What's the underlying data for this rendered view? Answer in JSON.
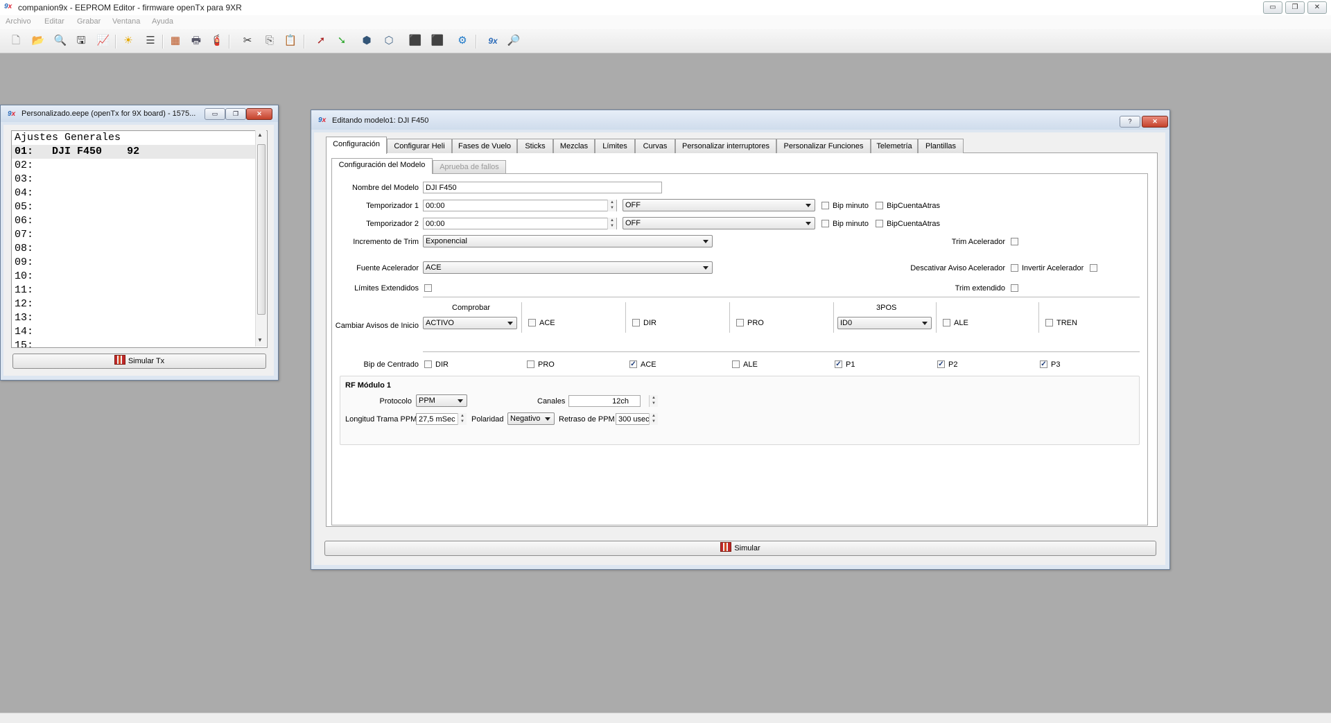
{
  "app": {
    "title": "companion9x - EEPROM Editor - firmware openTx para 9XR",
    "menu": [
      "Archivo",
      "Editar",
      "Grabar",
      "Ventana",
      "Ayuda"
    ],
    "window_controls": [
      "▭",
      "❐",
      "✕"
    ]
  },
  "eepe_window": {
    "title": "Personalizado.eepe (openTx for 9X board) - 1575...",
    "header": "Ajustes Generales",
    "models": [
      {
        "num": "01:",
        "name": "DJI F450",
        "size": "92"
      },
      {
        "num": "02:",
        "name": "",
        "size": ""
      },
      {
        "num": "03:",
        "name": "",
        "size": ""
      },
      {
        "num": "04:",
        "name": "",
        "size": ""
      },
      {
        "num": "05:",
        "name": "",
        "size": ""
      },
      {
        "num": "06:",
        "name": "",
        "size": ""
      },
      {
        "num": "07:",
        "name": "",
        "size": ""
      },
      {
        "num": "08:",
        "name": "",
        "size": ""
      },
      {
        "num": "09:",
        "name": "",
        "size": ""
      },
      {
        "num": "10:",
        "name": "",
        "size": ""
      },
      {
        "num": "11:",
        "name": "",
        "size": ""
      },
      {
        "num": "12:",
        "name": "",
        "size": ""
      },
      {
        "num": "13:",
        "name": "",
        "size": ""
      },
      {
        "num": "14:",
        "name": "",
        "size": ""
      },
      {
        "num": "15:",
        "name": "",
        "size": ""
      }
    ],
    "simulate_button": "Simular Tx"
  },
  "model_window": {
    "title": "Editando modelo1: DJI F450",
    "help": "?",
    "tabs": [
      "Configuración",
      "Configurar Heli",
      "Fases de Vuelo",
      "Sticks",
      "Mezclas",
      "Límites",
      "Curvas",
      "Personalizar interruptores",
      "Personalizar Funciones",
      "Telemetría",
      "Plantillas"
    ],
    "subtabs": [
      "Configuración del Modelo",
      "Aprueba de fallos"
    ],
    "model_name_label": "Nombre del Modelo",
    "model_name": "DJI F450",
    "timer1": {
      "label": "Temporizador 1",
      "value": "00:00",
      "mode": "OFF",
      "bip_min": "Bip minuto",
      "bip_count": "BipCuentaAtras"
    },
    "timer2": {
      "label": "Temporizador 2",
      "value": "00:00",
      "mode": "OFF",
      "bip_min": "Bip minuto",
      "bip_count": "BipCuentaAtras"
    },
    "trim_inc_label": "Incremento de Trim",
    "trim_inc": "Exponencial",
    "trim_throttle_label": "Trim Acelerador",
    "throttle_src_label": "Fuente Acelerador",
    "throttle_src": "ACE",
    "disable_throttle_warn": "Descativar Aviso Acelerador",
    "invert_throttle": "Invertir Acelerador",
    "extended_limits": "Límites Extendidos",
    "extended_trim": "Trim extendido",
    "warnings_label": "Cambiar Avisos de Inicio",
    "check_label": "Comprobar",
    "check_value": "ACTIVO",
    "pos3_label": "3POS",
    "pos3_value": "ID0",
    "warn_switches": [
      "ACE",
      "DIR",
      "PRO",
      "ALE",
      "TREN"
    ],
    "beep_center_label": "Bip de Centrado",
    "beep_center": [
      {
        "name": "DIR",
        "checked": false
      },
      {
        "name": "PRO",
        "checked": false
      },
      {
        "name": "ACE",
        "checked": true
      },
      {
        "name": "ALE",
        "checked": false
      },
      {
        "name": "P1",
        "checked": true
      },
      {
        "name": "P2",
        "checked": true
      },
      {
        "name": "P3",
        "checked": true
      }
    ],
    "rf": {
      "title": "RF Módulo 1",
      "protocol_label": "Protocolo",
      "protocol": "PPM",
      "channels_label": "Canales",
      "channels": "12ch",
      "frame_label": "Longitud Trama PPM",
      "frame": "27,5 mSec",
      "polarity_label": "Polaridad",
      "polarity": "Negativo",
      "delay_label": "Retraso de PPM",
      "delay": "300 usec"
    },
    "simulate_button": "Simular"
  }
}
